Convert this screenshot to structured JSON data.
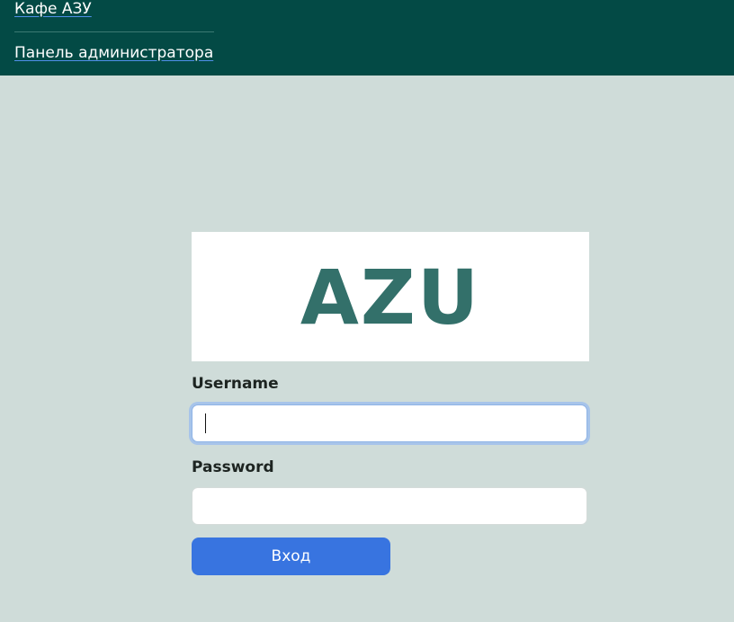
{
  "header": {
    "site_link": "Кафе АЗУ",
    "admin_link": "Панель администратора"
  },
  "logo": {
    "text": "AZU"
  },
  "login_form": {
    "username_label": "Username",
    "username_value": "",
    "password_label": "Password",
    "password_value": "",
    "submit_label": "Вход"
  },
  "colors": {
    "header_bg": "#034a45",
    "page_bg": "#cfdcd9",
    "logo_text": "#33706a",
    "button_bg": "#3874e0"
  }
}
